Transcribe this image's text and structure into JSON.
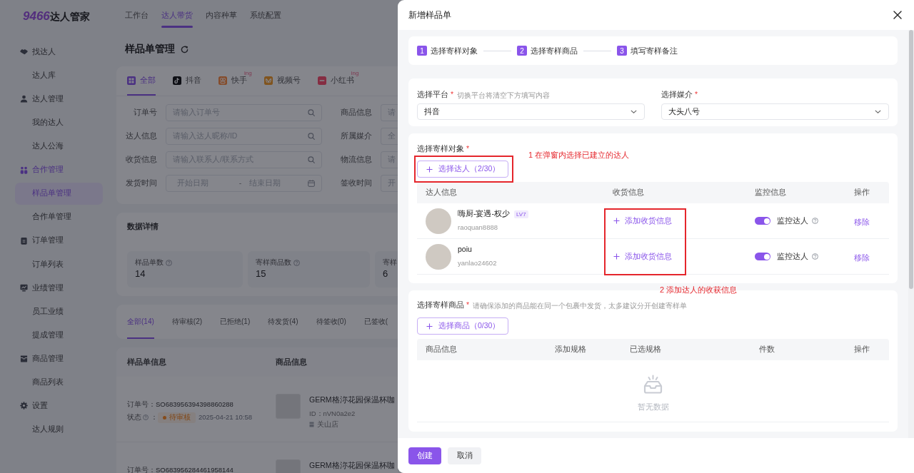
{
  "page": {
    "logo": {
      "number": "9466",
      "name": "达人管家"
    },
    "top_nav": [
      {
        "label": "工作台",
        "selected": false
      },
      {
        "label": "达人带货",
        "selected": true
      },
      {
        "label": "内容种草",
        "selected": false
      },
      {
        "label": "系统配置",
        "selected": false
      }
    ],
    "sidebar": [
      {
        "label": "找达人",
        "active": false,
        "children": [
          {
            "label": "达人库",
            "selected": false
          }
        ]
      },
      {
        "label": "达人管理",
        "active": false,
        "children": [
          {
            "label": "我的达人",
            "selected": false
          },
          {
            "label": "达人公海",
            "selected": false
          }
        ]
      },
      {
        "label": "合作管理",
        "active": true,
        "children": [
          {
            "label": "样品单管理",
            "selected": true
          },
          {
            "label": "合作单管理",
            "selected": false
          }
        ]
      },
      {
        "label": "订单管理",
        "active": false,
        "children": [
          {
            "label": "订单列表",
            "selected": false
          }
        ]
      },
      {
        "label": "业绩管理",
        "active": false,
        "children": [
          {
            "label": "员工业绩",
            "selected": false
          },
          {
            "label": "提成管理",
            "selected": false
          }
        ]
      },
      {
        "label": "商品管理",
        "active": false,
        "children": [
          {
            "label": "商品列表",
            "selected": false
          }
        ]
      },
      {
        "label": "设置",
        "active": false,
        "children": [
          {
            "label": "达人规则",
            "selected": false
          }
        ]
      }
    ],
    "title": "样品单管理",
    "platform_tabs": [
      {
        "label": "全部",
        "selected": true
      },
      {
        "label": "抖音",
        "selected": false
      },
      {
        "label": "快手",
        "selected": false,
        "badge": "ing"
      },
      {
        "label": "视频号",
        "selected": false
      },
      {
        "label": "小红书",
        "selected": false,
        "badge": "ing"
      }
    ],
    "filters": [
      {
        "label": "订单号",
        "kind": "search",
        "placeholder": "请输入订单号"
      },
      {
        "label": "商品信息",
        "kind": "partial",
        "placeholder": "请"
      },
      {
        "label": "达人信息",
        "kind": "search",
        "placeholder": "请输入达人昵称/ID"
      },
      {
        "label": "所属媒介",
        "kind": "partial",
        "placeholder": "全"
      },
      {
        "label": "收货信息",
        "kind": "search",
        "placeholder": "请输入联系人/联系方式"
      },
      {
        "label": "物流信息",
        "kind": "partial",
        "placeholder": "请"
      },
      {
        "label": "发货时间",
        "kind": "date_range",
        "start_placeholder": "开始日期",
        "separator": "-",
        "end_placeholder": "结束日期"
      },
      {
        "label": "签收时间",
        "kind": "partial",
        "placeholder": "开"
      }
    ],
    "summary": {
      "title": "数据详情",
      "stats": [
        {
          "label": "样品单数",
          "help": true,
          "value": "14"
        },
        {
          "label": "寄样商品数",
          "help": true,
          "value": "15"
        },
        {
          "label": "寄样",
          "help": false,
          "value": "6"
        }
      ]
    },
    "status_tabs": [
      {
        "label": "全部(14)",
        "selected": true
      },
      {
        "label": "待审核(2)",
        "selected": false
      },
      {
        "label": "已拒绝(1)",
        "selected": false
      },
      {
        "label": "待发货(4)",
        "selected": false
      },
      {
        "label": "待签收(0)",
        "selected": false
      },
      {
        "label": "已签收(",
        "selected": false
      }
    ],
    "orders": {
      "columns": [
        "样品单信息",
        "商品信息"
      ],
      "rows": [
        {
          "order_label": "订单号：",
          "order_no": "SO683956394398860288",
          "status_label": "状态",
          "status_separator": "：",
          "status": "待审核",
          "time": "2025-04-21 10:58",
          "product_name": "GERM格沵花园保温杯咖",
          "product_id": "ID：nVN0a2e2",
          "store": "关山店"
        },
        {
          "order_label": "订单号：",
          "order_no": "SO683956284461958144",
          "product_name": "GERM格沵花园保温杯咖"
        }
      ]
    }
  },
  "drawer": {
    "title": "新增样品单",
    "steps": [
      {
        "number": "1",
        "label": "选择寄样对象"
      },
      {
        "number": "2",
        "label": "选择寄样商品"
      },
      {
        "number": "3",
        "label": "填写寄样备注"
      }
    ],
    "selectors": [
      {
        "label": "选择平台",
        "required_mark": "*",
        "hint": "切换平台将清空下方填写内容",
        "value": "抖音"
      },
      {
        "label": "选择媒介",
        "required_mark": "*",
        "value": "大头八号"
      }
    ],
    "influencers": {
      "label": "选择寄样对象",
      "required_mark": "*",
      "button": "选择达人（2/30）",
      "note": "1 在弹窗内选择已建立的达人",
      "columns": [
        "达人信息",
        "收货信息",
        "监控信息",
        "操作"
      ],
      "rows": [
        {
          "name": "嗨厨-宴遇-权少",
          "badge": "LV7",
          "account": "raoquan8888",
          "address_action": "添加收货信息",
          "monitored": true,
          "monitor_label": "监控达人",
          "action": "移除"
        },
        {
          "name": "poiu",
          "account": "yanlao24602",
          "address_action": "添加收货信息",
          "monitored": true,
          "monitor_label": "监控达人",
          "action": "移除"
        }
      ],
      "address_note": "2 添加达人的收获信息"
    },
    "products": {
      "label": "选择寄样商品",
      "required_mark": "*",
      "hint": "请确保添加的商品能在同一个包裹中发货，太多建议分开创建寄样单",
      "button": "选择商品（0/30）",
      "columns": [
        "商品信息",
        "添加规格",
        "已选规格",
        "件数",
        "操作"
      ],
      "empty_text": "暂无数据"
    },
    "footer_buttons": [
      {
        "label": "创建",
        "kind": "primary"
      },
      {
        "label": "取消",
        "kind": "secondary"
      }
    ]
  }
}
